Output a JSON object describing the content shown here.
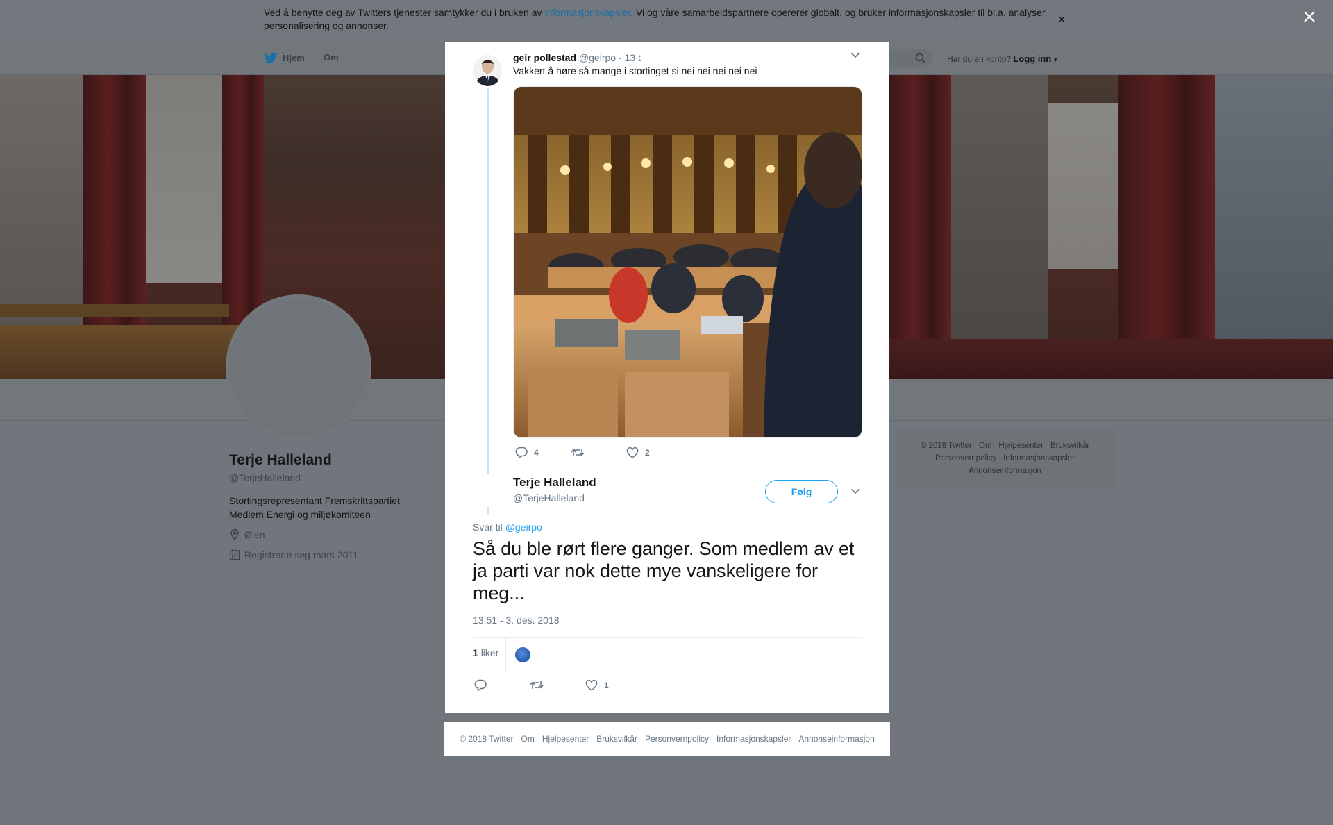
{
  "cookie_banner": {
    "text_before": "Ved å benytte deg av Twitters tjenester samtykker du i bruken av ",
    "link": "informasjonskapsler",
    "text_after": ". Vi og våre samarbeidspartnere opererer globalt, og bruker informasjonskapsler til bl.a. analyser, personalisering og annonser.",
    "close": "×"
  },
  "overlay_close": "✕",
  "nav": {
    "home": "Hjem",
    "about": "Om",
    "account_prompt": "Har du en konto?",
    "login": "Logg inn"
  },
  "profile": {
    "name": "Terje Halleland",
    "handle": "@TerjeHalleland",
    "bio_line1": "Stortingsrepresentant Fremskrittspartiet",
    "bio_line2": "Medlem Energi og miljøkomiteen",
    "location": "Ølen",
    "joined": "Registrerte seg mars 2011"
  },
  "side_footer": {
    "items": [
      "© 2018 Twitter",
      "Om",
      "Hjelpesenter",
      "Bruksvilkår",
      "Personvernpolicy",
      "Informasjonskapsler",
      "Annonseinformasjon"
    ]
  },
  "parent_tweet": {
    "name": "geir pollestad",
    "handle": "@geirpo",
    "time": "13 t",
    "text": "Vakkert å høre så mange i stortinget si nei nei nei nei nei",
    "replies": "4",
    "retweets": "",
    "likes": "2"
  },
  "reply_tweet": {
    "name": "Terje Halleland",
    "handle": "@TerjeHalleland",
    "follow_label": "Følg",
    "replying_to_label": "Svar til",
    "replying_to_handle": "@geirpo",
    "text": "Så du ble rørt flere ganger. Som medlem av et ja parti var nok dette mye vanskeligere for meg...",
    "timestamp": "13:51 - 3. des. 2018",
    "likes_count": "1",
    "likes_label": "liker",
    "action_likes": "1"
  },
  "modal_footer": {
    "items": [
      "© 2018 Twitter",
      "Om",
      "Hjelpesenter",
      "Bruksvilkår",
      "Personvernpolicy",
      "Informasjonskapsler",
      "Annonseinformasjon"
    ]
  },
  "colors": {
    "twitter_blue": "#1da1f2",
    "overlay": "#71767c",
    "thread_line": "#c9e3f7"
  }
}
